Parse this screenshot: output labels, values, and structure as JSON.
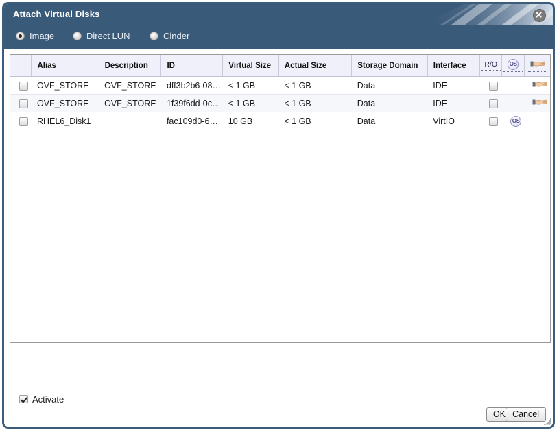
{
  "window": {
    "title": "Attach Virtual Disks",
    "close_icon": "close-icon",
    "resize_grip_icon": "resize-grip-icon"
  },
  "type_selector": {
    "options": [
      {
        "label": "Image",
        "selected": true
      },
      {
        "label": "Direct LUN",
        "selected": false
      },
      {
        "label": "Cinder",
        "selected": false
      }
    ]
  },
  "table": {
    "columns": [
      {
        "key": "select",
        "label": ""
      },
      {
        "key": "alias",
        "label": "Alias"
      },
      {
        "key": "description",
        "label": "Description"
      },
      {
        "key": "id",
        "label": "ID"
      },
      {
        "key": "virtual_size",
        "label": "Virtual Size"
      },
      {
        "key": "actual_size",
        "label": "Actual Size"
      },
      {
        "key": "storage_domain",
        "label": "Storage Domain"
      },
      {
        "key": "interface",
        "label": "Interface"
      },
      {
        "key": "read_only",
        "label": "R/O"
      },
      {
        "key": "os",
        "label": "OS",
        "icon": "os-badge-icon"
      },
      {
        "key": "bootable",
        "label": "",
        "icon": "pointing-hand-icon"
      }
    ],
    "rows": [
      {
        "selected": false,
        "alias": "OVF_STORE",
        "description": "OVF_STORE",
        "id": "dff3b2b6-08…",
        "virtual_size": "< 1 GB",
        "actual_size": "< 1 GB",
        "storage_domain": "Data",
        "interface": "IDE",
        "read_only": false,
        "os": false,
        "bootable": true
      },
      {
        "selected": false,
        "alias": "OVF_STORE",
        "description": "OVF_STORE",
        "id": "1f39f6dd-0c…",
        "virtual_size": "< 1 GB",
        "actual_size": "< 1 GB",
        "storage_domain": "Data",
        "interface": "IDE",
        "read_only": false,
        "os": false,
        "bootable": true
      },
      {
        "selected": false,
        "alias": "RHEL6_Disk1",
        "description": "",
        "id": "fac109d0-6…",
        "virtual_size": "10 GB",
        "actual_size": "< 1 GB",
        "storage_domain": "Data",
        "interface": "VirtIO",
        "read_only": false,
        "os": true,
        "bootable": false
      }
    ]
  },
  "activate": {
    "label": "Activate",
    "checked": true
  },
  "footer": {
    "ok_label": "OK",
    "cancel_label": "Cancel"
  },
  "colors": {
    "titlebar": "#3a5a7a",
    "frame_border": "#3c5c7c",
    "header_bg": "#eff0fa",
    "stripe_row": "#f6f7fb"
  }
}
